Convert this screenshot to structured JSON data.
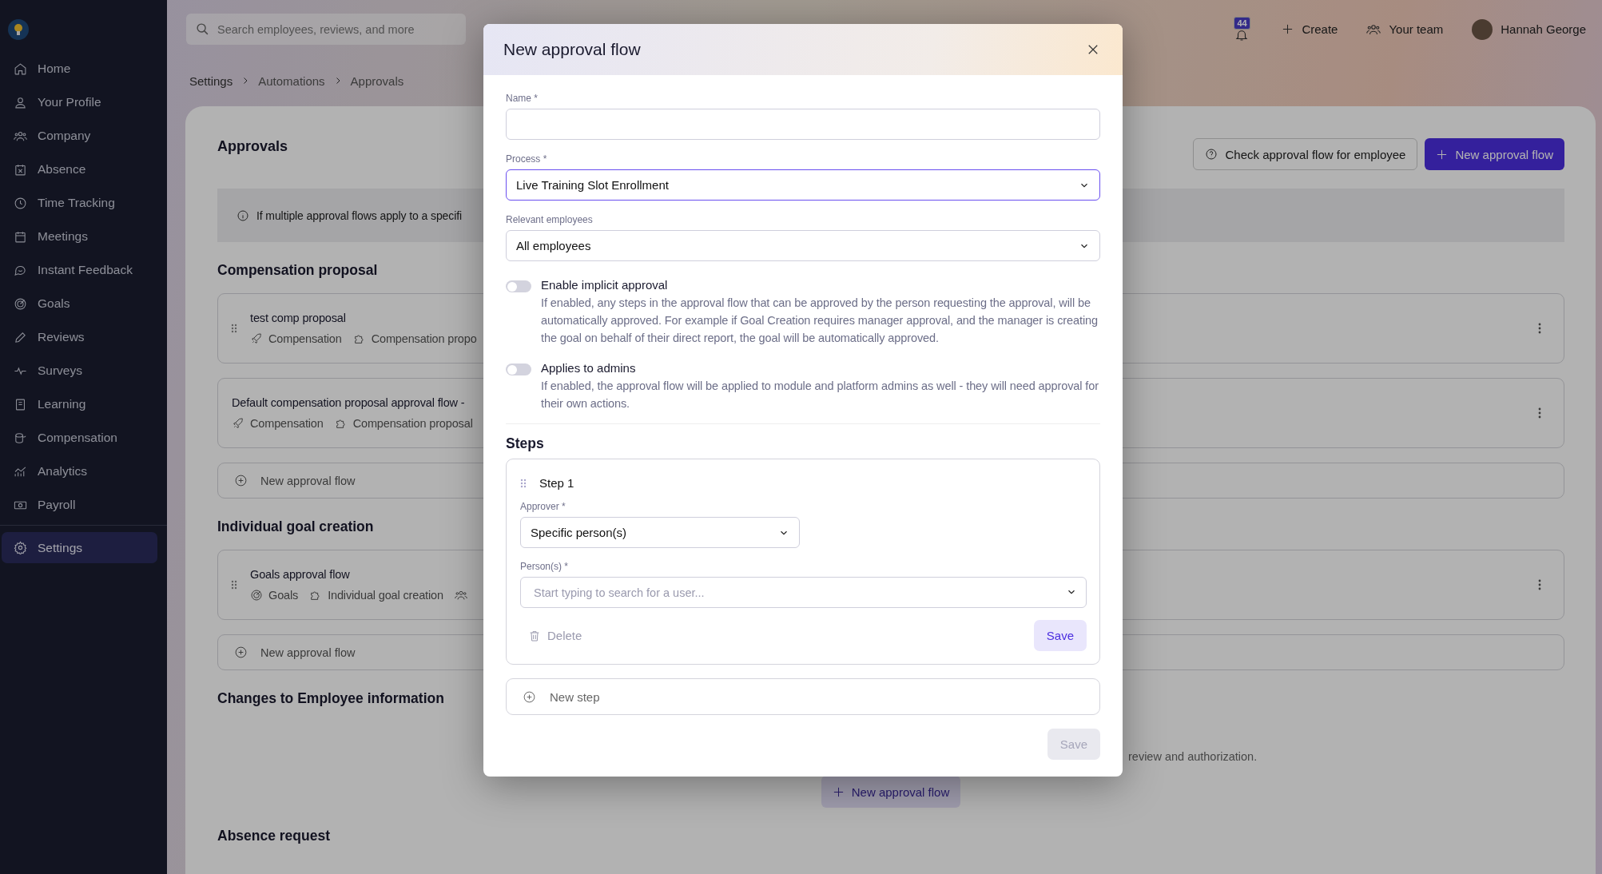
{
  "sidebar": {
    "items": [
      {
        "label": "Home",
        "selected": false
      },
      {
        "label": "Your Profile",
        "selected": false
      },
      {
        "label": "Company",
        "selected": false
      },
      {
        "label": "Absence",
        "selected": false
      },
      {
        "label": "Time Tracking",
        "selected": false
      },
      {
        "label": "Meetings",
        "selected": false
      },
      {
        "label": "Instant Feedback",
        "selected": false
      },
      {
        "label": "Goals",
        "selected": false
      },
      {
        "label": "Reviews",
        "selected": false
      },
      {
        "label": "Surveys",
        "selected": false
      },
      {
        "label": "Learning",
        "selected": false
      },
      {
        "label": "Compensation",
        "selected": false
      },
      {
        "label": "Analytics",
        "selected": false
      },
      {
        "label": "Payroll",
        "selected": false
      },
      {
        "label": "Settings",
        "selected": true
      }
    ]
  },
  "search": {
    "placeholder": "Search employees, reviews, and more"
  },
  "top_bar": {
    "notification_count": "44",
    "create": "Create",
    "team": "Your team",
    "user": "Hannah George"
  },
  "breadcrumb": [
    "Settings",
    "Automations",
    "Approvals"
  ],
  "page": {
    "title": "Approvals",
    "actions": [
      {
        "label": "Check approval flow for employee",
        "kind": "secondary"
      },
      {
        "label": "New approval flow",
        "kind": "primary"
      }
    ],
    "info": "If multiple approval flows apply to a specifi",
    "sections": [
      {
        "title": "Compensation proposal",
        "flows": [
          {
            "name": "test comp proposal",
            "draggable": true,
            "tags": [
              {
                "kind": "compensation",
                "label": "Compensation"
              },
              {
                "kind": "process",
                "label": "Compensation propo"
              }
            ]
          },
          {
            "name": "Default compensation proposal approval flow - ",
            "draggable": false,
            "tags": [
              {
                "kind": "compensation",
                "label": "Compensation"
              },
              {
                "kind": "process",
                "label": "Compensation proposal"
              }
            ]
          }
        ],
        "add_row": "New approval flow"
      },
      {
        "title": "Individual goal creation",
        "flows": [
          {
            "name": "Goals approval flow",
            "draggable": true,
            "tags": [
              {
                "kind": "goals",
                "label": "Goals"
              },
              {
                "kind": "process",
                "label": "Individual goal creation"
              },
              {
                "kind": "employees"
              }
            ]
          }
        ],
        "add_row": "New approval flow"
      },
      {
        "title": "Changes to Employee information",
        "empty_text": "review and authorization.",
        "add_button": "New approval flow"
      },
      {
        "title": "Absence request"
      }
    ]
  },
  "modal": {
    "title": "New approval flow",
    "fields": [
      {
        "label": "Name *",
        "kind": "text",
        "focused": false
      },
      {
        "label": "Process *",
        "kind": "select",
        "value": "Live Training Slot Enrollment",
        "focused": true
      },
      {
        "label": "Relevant employees",
        "kind": "select",
        "value": "All employees",
        "focused": false
      }
    ],
    "toggles": [
      {
        "label": "Enable implicit approval",
        "on": false,
        "description": "If enabled, any steps in the approval flow that can be approved by the person requesting the approval, will be automatically approved. For example if Goal Creation requires manager approval, and the manager is creating the goal on behalf of their direct report, the goal will be automatically approved."
      },
      {
        "label": "Applies to admins",
        "on": false,
        "description": "If enabled, the approval flow will be applied to module and platform admins as well - they will need approval for their own actions."
      }
    ],
    "steps_title": "Steps",
    "steps": [
      {
        "title": "Step 1",
        "approver_label": "Approver *",
        "approver": "Specific person(s)",
        "persons_label": "Person(s) *",
        "persons_placeholder": "Start typing to search for a user...",
        "delete": "Delete",
        "save": {
          "label": "Save",
          "disabled": false
        }
      }
    ],
    "new_step": "New step",
    "save": {
      "label": "Save",
      "disabled": true
    }
  }
}
